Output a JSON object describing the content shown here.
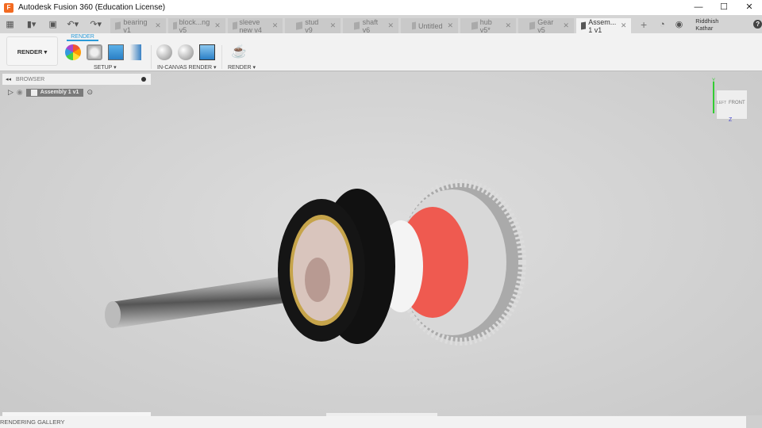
{
  "window": {
    "title": "Autodesk Fusion 360 (Education License)",
    "logo": "F",
    "minimize": "—",
    "maximize": "☐",
    "close": "✕"
  },
  "tabs": [
    {
      "label": "bearing v1"
    },
    {
      "label": "block...ng v5"
    },
    {
      "label": "sleeve new v4"
    },
    {
      "label": "stud v9"
    },
    {
      "label": "shaft v6"
    },
    {
      "label": "Untitled"
    },
    {
      "label": "hub v5*"
    },
    {
      "label": "Gear v5"
    },
    {
      "label": "Assem... 1 v1",
      "active": true
    }
  ],
  "tab_close": "✕",
  "new_tab": "+",
  "user": "Riddhish Kathar",
  "help": "?",
  "ribbon": {
    "workspace": "RENDER ▾",
    "tab": "RENDER",
    "groups": [
      "SETUP ▾",
      "IN-CANVAS RENDER ▾",
      "RENDER ▾"
    ]
  },
  "browser": {
    "title": "BROWSER",
    "collapse": "◂◂",
    "root": "Assembly 1 v1"
  },
  "viewcube": {
    "front": "FRONT",
    "left": "LEFT",
    "y": "Y",
    "z": "Z"
  },
  "status": {
    "gallery": "RENDERING GALLERY"
  }
}
